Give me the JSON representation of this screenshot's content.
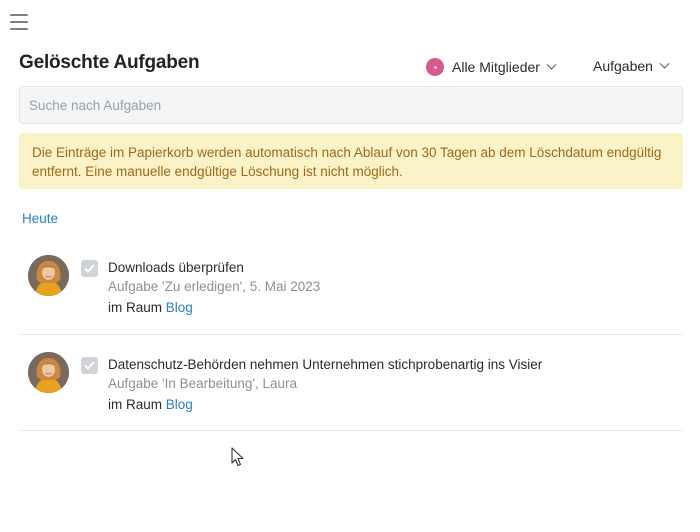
{
  "header": {
    "title": "Gelöschte Aufgaben",
    "members_filter": "Alle Mitglieder",
    "type_filter": "Aufgaben"
  },
  "search": {
    "placeholder": "Suche nach Aufgaben",
    "value": ""
  },
  "notice": {
    "text": "Die Einträge im Papierkorb werden automatisch nach Ablauf von 30 Tagen ab dem Löschdatum endgültig entfernt. Eine manuelle endgültige Löschung ist nicht möglich."
  },
  "sections": [
    {
      "label": "Heute",
      "tasks": [
        {
          "title": "Downloads überprüfen",
          "meta": "Aufgabe 'Zu erledigen', 5. Mai 2023",
          "room_prefix": "im Raum",
          "room": "Blog",
          "done": true
        },
        {
          "title": "Datenschutz-Behörden nehmen Unternehmen stichprobenartig ins Visier",
          "meta": "Aufgabe 'In Bearbeitung', Laura",
          "room_prefix": "im Raum",
          "room": "Blog",
          "done": true
        }
      ]
    }
  ],
  "colors": {
    "accent": "#2e7ec4",
    "notice_bg": "#fbf3c8",
    "notice_text": "#a0671c",
    "member_dot": "#d75a8f"
  },
  "icons": {
    "menu": "hamburger-icon",
    "dropdown": "chevron-down-icon",
    "check": "checkmark-icon",
    "pointer": "mouse-cursor-icon"
  }
}
